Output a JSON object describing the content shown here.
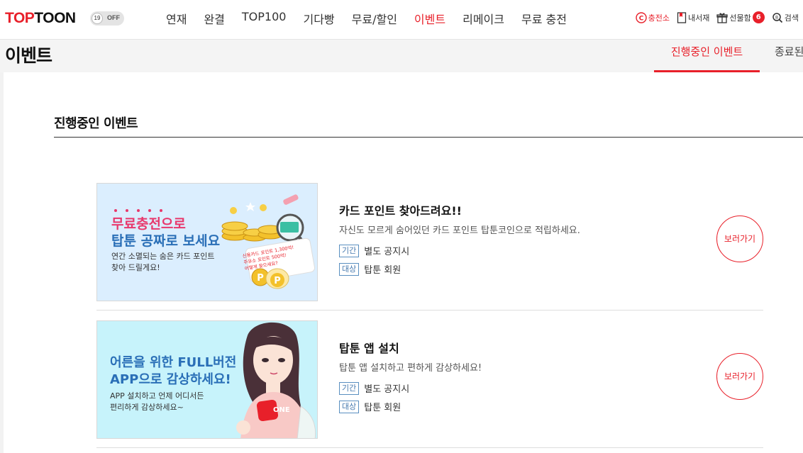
{
  "header": {
    "logo": {
      "part1": "TOP",
      "part2": "TOON"
    },
    "adult_toggle": {
      "age": "19",
      "state": "OFF"
    },
    "nav": [
      "연재",
      "완결",
      "TOP100",
      "기다빵",
      "무료/할인",
      "이벤트",
      "리메이크",
      "무료 충전"
    ],
    "active_nav": "이벤트",
    "util": {
      "charge": "충전소",
      "library": "내서재",
      "gifts": "선물함",
      "gift_count": "6",
      "search": "검색"
    }
  },
  "page": {
    "title": "이벤트",
    "tabs": [
      "진행중인 이벤트",
      "종료된"
    ],
    "section_heading": "진행중인 이벤트"
  },
  "events": [
    {
      "banner": {
        "headline1": "무료충전으로",
        "headline2": "탑툰 공짜로 보세요",
        "sub1": "연간 소멸되는 숨은 카드 포인트",
        "sub2": "찾아 드릴게요!",
        "card1": "신용카드 포인트 1,300억!",
        "card2": "주유소 포인트 500억!",
        "card3": "어떻게 찾으세요?"
      },
      "title": "카드 포인트 찾아드려요!!",
      "desc": "자신도 모르게 숨어있던 카드 포인트 탑툰코인으로 적립하세요.",
      "period_label": "기간",
      "period": "별도 공지시",
      "target_label": "대상",
      "target": "탑툰 회원",
      "button": "보러가기"
    },
    {
      "banner": {
        "headline1": "어른을 위한 FULL버전",
        "headline2": "APP으로 감상하세요!",
        "sub1": "APP 설치하고 언제 어디서든",
        "sub2": "편리하게 감상하세요~",
        "app_label": "ONE"
      },
      "title": "탑툰 앱 설치",
      "desc": "탑툰 앱 설치하고 편하게 감상하세요!",
      "period_label": "기간",
      "period": "별도 공지시",
      "target_label": "대상",
      "target": "탑툰 회원",
      "button": "보러가기"
    }
  ],
  "colors": {
    "brand": "#e8202a",
    "tag": "#4a7cb0"
  }
}
